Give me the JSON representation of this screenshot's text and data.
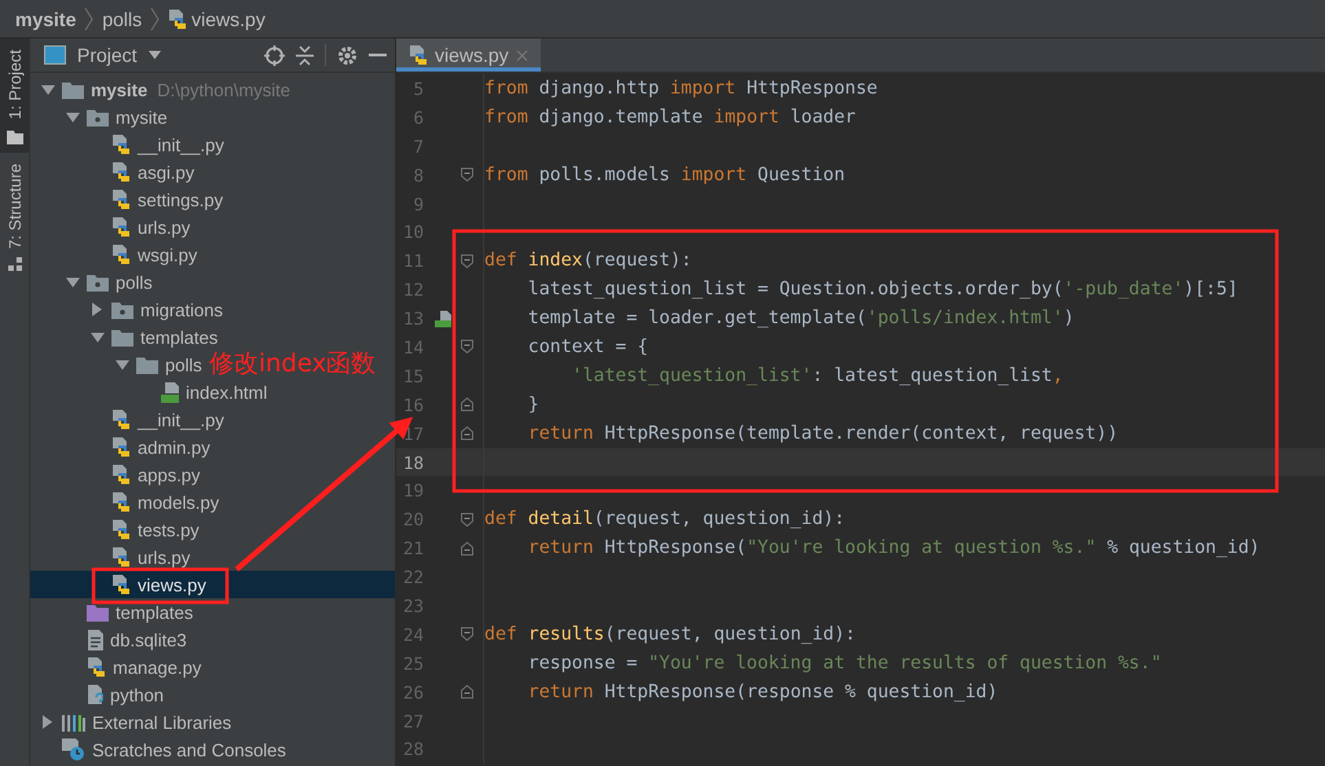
{
  "breadcrumbs": [
    {
      "label": "mysite",
      "kind": "folder"
    },
    {
      "label": "polls",
      "kind": "folder"
    },
    {
      "label": "views.py",
      "kind": "py"
    }
  ],
  "tool_strip": [
    {
      "label": "1: Project",
      "selected": true,
      "kind": "project"
    },
    {
      "label": "7: Structure",
      "selected": false,
      "kind": "structure"
    }
  ],
  "project_panel": {
    "title": "Project",
    "tree": [
      {
        "label": "mysite",
        "path": "D:\\python\\mysite",
        "kind": "folder",
        "expanded": true,
        "selected": false,
        "children": [
          {
            "label": "mysite",
            "kind": "package",
            "expanded": true,
            "selected": false,
            "children": [
              {
                "label": "__init__.py",
                "kind": "py",
                "selected": false
              },
              {
                "label": "asgi.py",
                "kind": "py",
                "selected": false
              },
              {
                "label": "settings.py",
                "kind": "py",
                "selected": false
              },
              {
                "label": "urls.py",
                "kind": "py",
                "selected": false
              },
              {
                "label": "wsgi.py",
                "kind": "py",
                "selected": false
              }
            ]
          },
          {
            "label": "polls",
            "kind": "package",
            "expanded": true,
            "selected": false,
            "children": [
              {
                "label": "migrations",
                "kind": "package",
                "expanded": false,
                "selected": false
              },
              {
                "label": "templates",
                "kind": "folder",
                "expanded": true,
                "selected": false,
                "children": [
                  {
                    "label": "polls",
                    "kind": "folder",
                    "expanded": true,
                    "selected": false,
                    "children": [
                      {
                        "label": "index.html",
                        "kind": "html",
                        "selected": false
                      }
                    ]
                  }
                ]
              },
              {
                "label": "__init__.py",
                "kind": "py",
                "selected": false
              },
              {
                "label": "admin.py",
                "kind": "py",
                "selected": false
              },
              {
                "label": "apps.py",
                "kind": "py",
                "selected": false
              },
              {
                "label": "models.py",
                "kind": "py",
                "selected": false
              },
              {
                "label": "tests.py",
                "kind": "py",
                "selected": false
              },
              {
                "label": "urls.py",
                "kind": "py",
                "selected": false
              },
              {
                "label": "views.py",
                "kind": "py",
                "selected": true
              }
            ]
          },
          {
            "label": "templates",
            "kind": "templates",
            "selected": false
          },
          {
            "label": "db.sqlite3",
            "kind": "db",
            "selected": false
          },
          {
            "label": "manage.py",
            "kind": "py",
            "selected": false
          },
          {
            "label": "python",
            "kind": "unknown",
            "selected": false
          }
        ]
      },
      {
        "label": "External Libraries",
        "kind": "libraries",
        "expanded": false,
        "selected": false
      },
      {
        "label": "Scratches and Consoles",
        "kind": "scratches",
        "selected": false
      }
    ]
  },
  "editor": {
    "tabs": [
      {
        "label": "views.py",
        "selected": true
      }
    ],
    "lines": [
      {
        "number": "5",
        "kind": "code",
        "current": false,
        "tokens": [
          {
            "kind": "kw",
            "text": "from"
          },
          {
            "kind": "plain",
            "text": " django.http "
          },
          {
            "kind": "kw",
            "text": "import"
          },
          {
            "kind": "plain",
            "text": " HttpResponse"
          }
        ]
      },
      {
        "number": "6",
        "kind": "code",
        "current": false,
        "tokens": [
          {
            "kind": "kw",
            "text": "from"
          },
          {
            "kind": "plain",
            "text": " django.template "
          },
          {
            "kind": "kw",
            "text": "import"
          },
          {
            "kind": "plain",
            "text": " loader"
          }
        ]
      },
      {
        "number": "7",
        "kind": "code",
        "current": false
      },
      {
        "number": "8",
        "kind": "fold-start",
        "current": false,
        "tokens": [
          {
            "kind": "kw",
            "text": "from"
          },
          {
            "kind": "plain",
            "text": " polls.models "
          },
          {
            "kind": "kw",
            "text": "import"
          },
          {
            "kind": "plain",
            "text": " Question"
          }
        ]
      },
      {
        "number": "9",
        "kind": "code",
        "current": false
      },
      {
        "number": "10",
        "kind": "code",
        "current": false
      },
      {
        "number": "11",
        "kind": "fold-start",
        "current": false,
        "tokens": [
          {
            "kind": "kw",
            "text": "def "
          },
          {
            "kind": "fn",
            "text": "index"
          },
          {
            "kind": "plain",
            "text": "(request):"
          }
        ]
      },
      {
        "number": "12",
        "kind": "code",
        "current": false,
        "tokens": [
          {
            "kind": "plain",
            "text": "    latest_question_list = Question.objects.order_by("
          },
          {
            "kind": "str",
            "text": "'-pub_date'"
          },
          {
            "kind": "plain",
            "text": ")[:5]"
          }
        ]
      },
      {
        "number": "13",
        "kind": "template-marker",
        "current": false,
        "tokens": [
          {
            "kind": "plain",
            "text": "    template = loader.get_template("
          },
          {
            "kind": "str",
            "text": "'polls/index.html'"
          },
          {
            "kind": "plain",
            "text": ")"
          }
        ]
      },
      {
        "number": "14",
        "kind": "fold-start",
        "current": false,
        "tokens": [
          {
            "kind": "plain",
            "text": "    context = {"
          }
        ]
      },
      {
        "number": "15",
        "kind": "code",
        "current": false,
        "tokens": [
          {
            "kind": "str",
            "text": "        'latest_question_list'"
          },
          {
            "kind": "plain",
            "text": ": latest_question_list"
          },
          {
            "kind": "kw",
            "text": ","
          }
        ]
      },
      {
        "number": "16",
        "kind": "fold-end",
        "current": false,
        "tokens": [
          {
            "kind": "plain",
            "text": "    }"
          }
        ]
      },
      {
        "number": "17",
        "kind": "fold-end",
        "current": false,
        "tokens": [
          {
            "kind": "kw",
            "text": "    return"
          },
          {
            "kind": "plain",
            "text": " HttpResponse(template.render(context, request))"
          }
        ]
      },
      {
        "number": "18",
        "kind": "code",
        "current": true
      },
      {
        "number": "19",
        "kind": "code",
        "current": false
      },
      {
        "number": "20",
        "kind": "fold-start",
        "current": false,
        "tokens": [
          {
            "kind": "kw",
            "text": "def "
          },
          {
            "kind": "fn",
            "text": "detail"
          },
          {
            "kind": "plain",
            "text": "(request, question_id):"
          }
        ]
      },
      {
        "number": "21",
        "kind": "fold-end",
        "current": false,
        "tokens": [
          {
            "kind": "kw",
            "text": "    return"
          },
          {
            "kind": "plain",
            "text": " HttpResponse("
          },
          {
            "kind": "str",
            "text": "\"You're looking at question %s.\""
          },
          {
            "kind": "plain",
            "text": " % question_id)"
          }
        ]
      },
      {
        "number": "22",
        "kind": "code",
        "current": false
      },
      {
        "number": "23",
        "kind": "code",
        "current": false
      },
      {
        "number": "24",
        "kind": "fold-start",
        "current": false,
        "tokens": [
          {
            "kind": "kw",
            "text": "def "
          },
          {
            "kind": "fn",
            "text": "results"
          },
          {
            "kind": "plain",
            "text": "(request, question_id):"
          }
        ]
      },
      {
        "number": "25",
        "kind": "code",
        "current": false,
        "tokens": [
          {
            "kind": "plain",
            "text": "    response = "
          },
          {
            "kind": "str",
            "text": "\"You're looking at the results of question %s.\""
          }
        ]
      },
      {
        "number": "26",
        "kind": "fold-end",
        "current": false,
        "tokens": [
          {
            "kind": "kw",
            "text": "    return"
          },
          {
            "kind": "plain",
            "text": " HttpResponse(response % question_id)"
          }
        ]
      },
      {
        "number": "27",
        "kind": "code",
        "current": false
      },
      {
        "number": "28",
        "kind": "code",
        "current": false
      }
    ]
  },
  "annotation": {
    "label": "修改index函数"
  }
}
